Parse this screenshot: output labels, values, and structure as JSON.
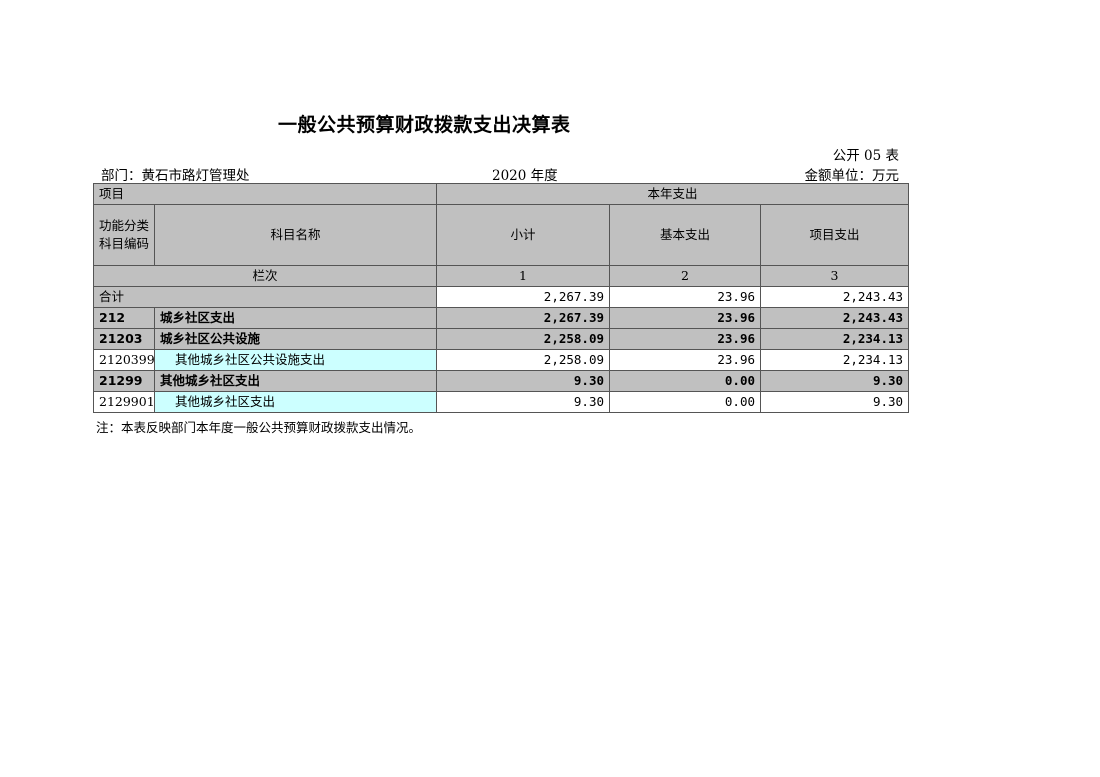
{
  "title": "一般公共预算财政拨款支出决算表",
  "form_code": "公开 05 表",
  "department": "部门：黄石市路灯管理处",
  "year": "2020 年度",
  "unit": "金额单位：万元",
  "headers": {
    "item": "项目",
    "current_year": "本年支出",
    "code": "功能分类科目编码",
    "name": "科目名称",
    "subtotal": "小计",
    "basic": "基本支出",
    "project": "项目支出",
    "column_order": "栏次",
    "col1": "1",
    "col2": "2",
    "col3": "3"
  },
  "total": {
    "label": "合计",
    "subtotal": "2,267.39",
    "basic": "23.96",
    "project": "2,243.43"
  },
  "rows": [
    {
      "code": "212",
      "name": "城乡社区支出",
      "subtotal": "2,267.39",
      "basic": "23.96",
      "project": "2,243.43"
    },
    {
      "code": "21203",
      "name": "城乡社区公共设施",
      "subtotal": "2,258.09",
      "basic": "23.96",
      "project": "2,234.13"
    },
    {
      "code": "2120399",
      "name": "其他城乡社区公共设施支出",
      "subtotal": "2,258.09",
      "basic": "23.96",
      "project": "2,234.13"
    },
    {
      "code": "21299",
      "name": "其他城乡社区支出",
      "subtotal": "9.30",
      "basic": "0.00",
      "project": "9.30"
    },
    {
      "code": "2129901",
      "name": "其他城乡社区支出",
      "subtotal": "9.30",
      "basic": "0.00",
      "project": "9.30"
    }
  ],
  "note": "注：本表反映部门本年度一般公共预算财政拨款支出情况。",
  "colors": {
    "header_gray": "#c0c0c0",
    "leaf_cyan": "#ccffff"
  }
}
